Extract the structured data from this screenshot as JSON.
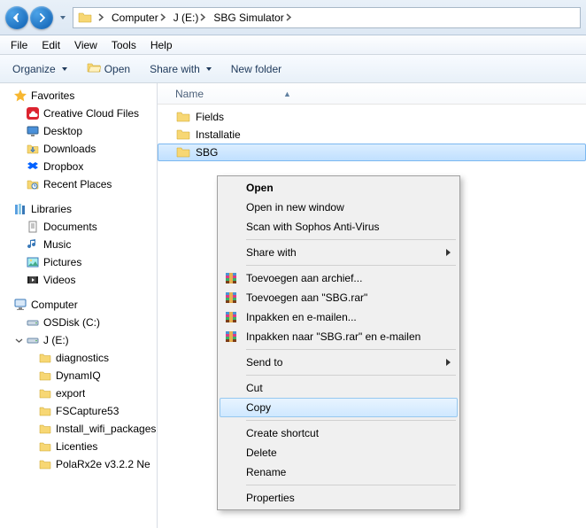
{
  "breadcrumb": {
    "items": [
      "Computer",
      "J (E:)",
      "SBG Simulator"
    ]
  },
  "menubar": [
    "File",
    "Edit",
    "View",
    "Tools",
    "Help"
  ],
  "toolbar": {
    "organize": "Organize",
    "open": "Open",
    "sharewith": "Share with",
    "newfolder": "New folder"
  },
  "sidebar": {
    "favorites_label": "Favorites",
    "favorites": [
      "Creative Cloud Files",
      "Desktop",
      "Downloads",
      "Dropbox",
      "Recent Places"
    ],
    "libraries_label": "Libraries",
    "libraries": [
      "Documents",
      "Music",
      "Pictures",
      "Videos"
    ],
    "computer_label": "Computer",
    "drives": [
      "OSDisk (C:)",
      "J (E:)"
    ],
    "j_children": [
      "diagnostics",
      "DynamIQ",
      "export",
      "FSCapture53",
      "Install_wifi_packages",
      "Licenties",
      "PolaRx2e v3.2.2 Ne"
    ]
  },
  "content": {
    "column_name": "Name",
    "items": [
      "Fields",
      "Installatie",
      "SBG"
    ]
  },
  "context_menu": {
    "open": "Open",
    "open_new": "Open in new window",
    "scan": "Scan with Sophos Anti-Virus",
    "share_with": "Share with",
    "rar_add": "Toevoegen aan archief...",
    "rar_add_sbg": "Toevoegen aan \"SBG.rar\"",
    "rar_email": "Inpakken en e-mailen...",
    "rar_email_sbg": "Inpakken naar \"SBG.rar\" en e-mailen",
    "send_to": "Send to",
    "cut": "Cut",
    "copy": "Copy",
    "create_shortcut": "Create shortcut",
    "delete": "Delete",
    "rename": "Rename",
    "properties": "Properties"
  }
}
